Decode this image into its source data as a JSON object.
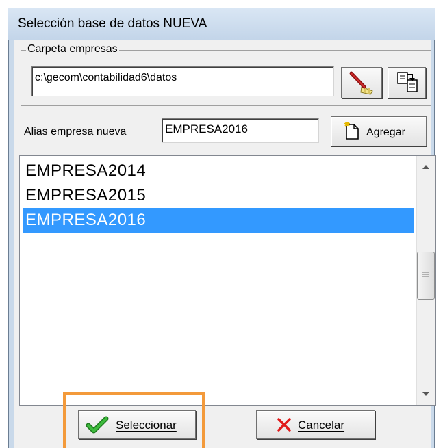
{
  "window": {
    "title": "Selección base de datos NUEVA"
  },
  "folder_group": {
    "legend": "Carpeta empresas",
    "path_value": "c:\\gecom\\contabilidad6\\datos"
  },
  "alias": {
    "label": "Alias empresa nueva",
    "value": "EMPRESA2016",
    "add_button": "Agregar"
  },
  "companies": {
    "items": [
      "EMPRESA2014",
      "EMPRESA2015",
      "EMPRESA2016"
    ],
    "selected": "EMPRESA2016"
  },
  "actions": {
    "select_label": "Seleccionar",
    "cancel_label": "Cancelar"
  },
  "colors": {
    "selection": "#3399ff",
    "highlight_frame": "#f39a3b",
    "check_icon": "#2e9a2e",
    "cancel_icon": "#e11b1b"
  }
}
